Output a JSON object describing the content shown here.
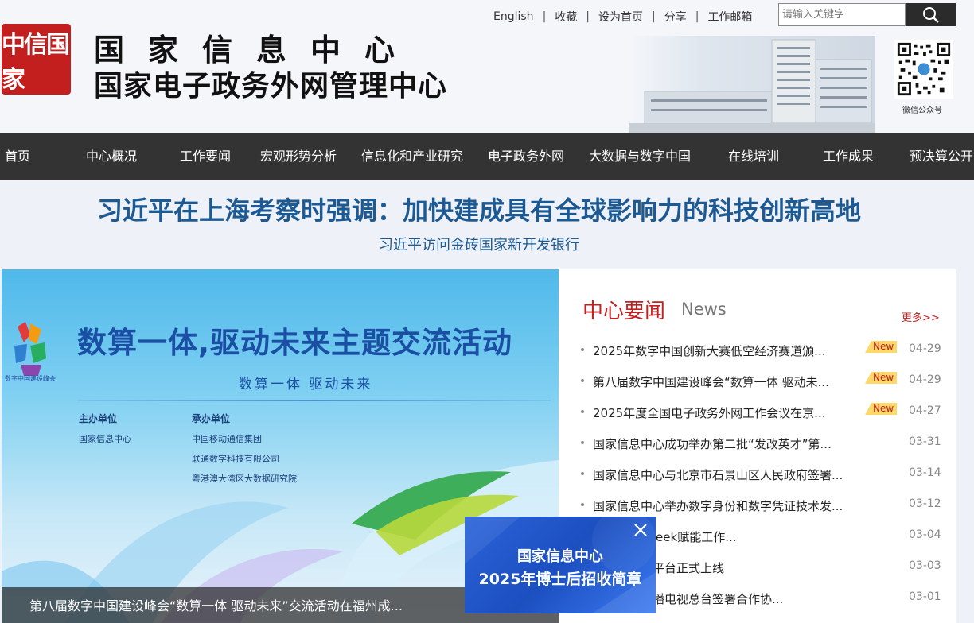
{
  "header": {
    "logo_glyphs": "中信国家",
    "title_line1": "国家信息中心",
    "title_line2": "国家电子政务外网管理中心",
    "top_links": [
      "English",
      "收藏",
      "设为首页",
      "分享",
      "工作邮箱"
    ],
    "search_placeholder": "请输入关键字",
    "qr_caption": "微信公众号"
  },
  "nav": {
    "items": [
      "首页",
      "中心概况",
      "工作要闻",
      "宏观形势分析",
      "信息化和产业研究",
      "电子政务外网",
      "大数据与数字中国",
      "在线培训",
      "工作成果",
      "预决算公开"
    ]
  },
  "headline": {
    "title": "习近平在上海考察时强调：加快建成具有全球影响力的科技创新高地",
    "subtitle": "习近平访问金砖国家新开发银行"
  },
  "banner": {
    "title": "数算一体,驱动未来主题交流活动",
    "subtitle": "数算一体   驱动未来",
    "logo_text": "数字中国建设峰会",
    "host_label": "主办单位",
    "host": "国家信息中心",
    "organizer_label": "承办单位",
    "organizers": [
      "中国移动通信集团",
      "联通数字科技有限公司",
      "粤港澳大湾区大数据研究院"
    ],
    "caption": "第八届数字中国建设峰会“数算一体 驱动未来”交流活动在福州成..."
  },
  "news": {
    "title": "中心要闻",
    "title_en": "News",
    "more": "更多>>",
    "badge_label": "New",
    "items": [
      {
        "text": "2025年数字中国创新大赛低空经济赛道颁...",
        "date": "04-29",
        "is_new": true
      },
      {
        "text": "第八届数字中国建设峰会“数算一体 驱动未...",
        "date": "04-29",
        "is_new": true
      },
      {
        "text": "2025年度全国电子政务外网工作会议在京...",
        "date": "04-27",
        "is_new": true
      },
      {
        "text": "国家信息中心成功举办第二批“发改英才”第...",
        "date": "03-31",
        "is_new": false
      },
      {
        "text": "国家信息中心与北京市石景山区人民政府签署...",
        "date": "03-14",
        "is_new": false
      },
      {
        "text": "国家信息中心举办数字身份和数字凭证技术发...",
        "date": "03-12",
        "is_new": false
      },
      {
        "text": "——DeepSeek赋能工作...",
        "date": "03-04",
        "is_new": false
      },
      {
        "text": "据资源登记平台正式上线",
        "date": "03-03",
        "is_new": false
      },
      {
        "text": "心与中央广播电视总台签署合作协...",
        "date": "03-01",
        "is_new": false
      }
    ]
  },
  "popup": {
    "line1": "国家信息中心",
    "line2": "2025年博士后招收简章"
  },
  "colors": {
    "brand_red": "#c41f1f",
    "nav_bg": "#333333",
    "headline_blue": "#1d5a93",
    "banner_blue": "#1a4fa3",
    "new_badge": "#ffd86a"
  }
}
